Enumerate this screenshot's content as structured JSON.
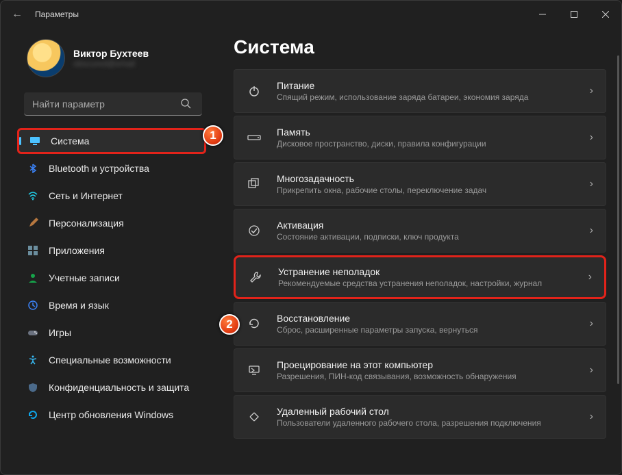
{
  "window": {
    "title": "Параметры"
  },
  "user": {
    "name": "Виктор Бухтеев",
    "email": "obscured@email"
  },
  "search": {
    "placeholder": "Найти параметр"
  },
  "nav": [
    {
      "label": "Система",
      "icon": "monitor",
      "active": true
    },
    {
      "label": "Bluetooth и устройства",
      "icon": "bluetooth"
    },
    {
      "label": "Сеть и Интернет",
      "icon": "wifi"
    },
    {
      "label": "Персонализация",
      "icon": "brush"
    },
    {
      "label": "Приложения",
      "icon": "apps"
    },
    {
      "label": "Учетные записи",
      "icon": "person"
    },
    {
      "label": "Время и язык",
      "icon": "clock"
    },
    {
      "label": "Игры",
      "icon": "gamepad"
    },
    {
      "label": "Специальные возможности",
      "icon": "accessibility"
    },
    {
      "label": "Конфиденциальность и защита",
      "icon": "shield"
    },
    {
      "label": "Центр обновления Windows",
      "icon": "update"
    }
  ],
  "main": {
    "title": "Система",
    "cards": [
      {
        "title": "Питание",
        "sub": "Спящий режим, использование заряда батареи, экономия заряда",
        "icon": "power"
      },
      {
        "title": "Память",
        "sub": "Дисковое пространство, диски, правила конфигурации",
        "icon": "storage"
      },
      {
        "title": "Многозадачность",
        "sub": "Прикрепить окна, рабочие столы, переключение задач",
        "icon": "multitask"
      },
      {
        "title": "Активация",
        "sub": "Состояние активации, подписки, ключ продукта",
        "icon": "check"
      },
      {
        "title": "Устранение неполадок",
        "sub": "Рекомендуемые средства устранения неполадок, настройки, журнал",
        "icon": "wrench",
        "highlight": true
      },
      {
        "title": "Восстановление",
        "sub": "Сброс, расширенные параметры запуска, вернуться",
        "icon": "recovery"
      },
      {
        "title": "Проецирование на этот компьютер",
        "sub": "Разрешения, ПИН-код связывания, возможность обнаружения",
        "icon": "project"
      },
      {
        "title": "Удаленный рабочий стол",
        "sub": "Пользователи удаленного рабочего стола, разрешения подключения",
        "icon": "remote"
      }
    ]
  },
  "annotations": {
    "one": "1",
    "two": "2"
  }
}
